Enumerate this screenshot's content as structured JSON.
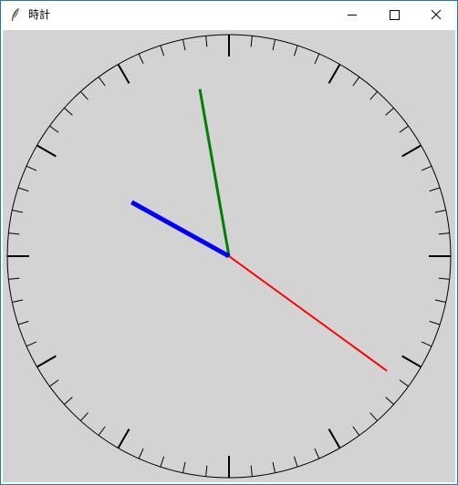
{
  "window": {
    "title": "時計",
    "controls": {
      "minimize_icon": "minimize-icon",
      "maximize_icon": "maximize-icon",
      "close_icon": "close-icon"
    }
  },
  "clock": {
    "background": "#d3d3d3",
    "time": {
      "hours": 9,
      "minutes": 58,
      "seconds": 21
    },
    "hands": {
      "hour": {
        "color": "#0000ff"
      },
      "minute": {
        "color": "#008000"
      },
      "second": {
        "color": "#ff0000"
      }
    },
    "tick_count": 60
  }
}
